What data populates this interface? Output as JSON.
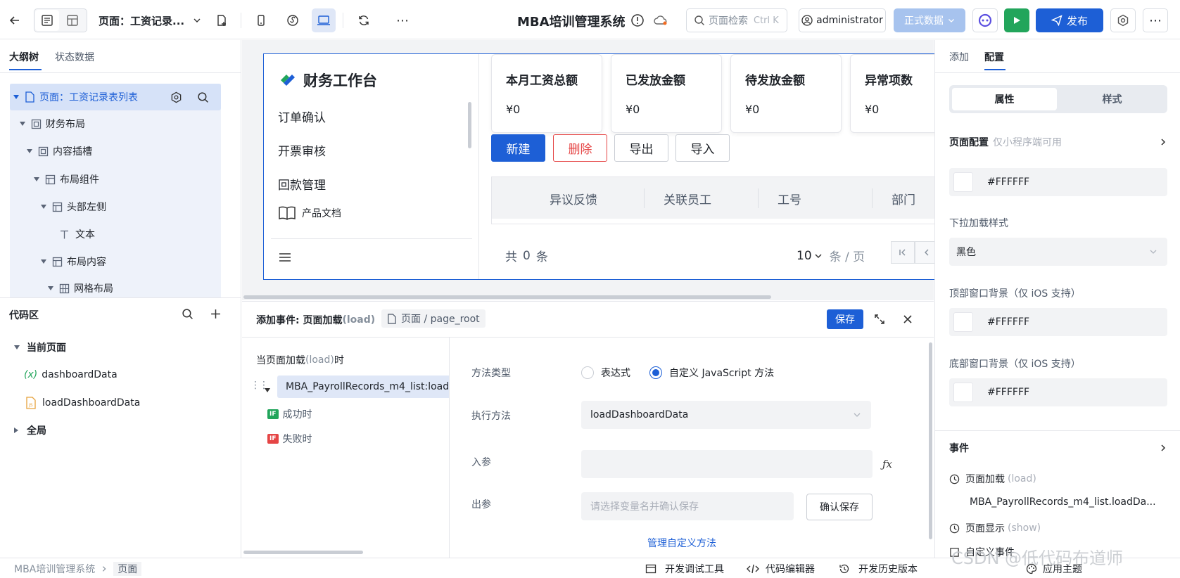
{
  "header": {
    "page_selector": "页面：工资记录...",
    "app_title": "MBA培训管理系统",
    "search_placeholder": "页面检索",
    "search_shortcut": "Ctrl K",
    "user": "administrator",
    "env": "正式数据",
    "publish": "发布"
  },
  "left": {
    "tabs": [
      "大纲树",
      "状态数据"
    ],
    "tree": [
      {
        "label": "页面：工资记录表列表"
      },
      {
        "label": "财务布局"
      },
      {
        "label": "内容插槽"
      },
      {
        "label": "布局组件"
      },
      {
        "label": "头部左侧"
      },
      {
        "label": "文本"
      },
      {
        "label": "布局内容"
      },
      {
        "label": "网格布局"
      }
    ],
    "code_title": "代码区",
    "current_page": "当前页面",
    "vars": [
      "dashboardData",
      "loadDashboardData"
    ],
    "global": "全局"
  },
  "canvas": {
    "logo_title": "财务工作台",
    "menu": [
      "订单确认",
      "开票审核",
      "回款管理"
    ],
    "doc_link": "产品文档",
    "cards": [
      {
        "title": "本月工资总额",
        "value": "¥0"
      },
      {
        "title": "已发放金额",
        "value": "¥0"
      },
      {
        "title": "待发放金额",
        "value": "¥0"
      },
      {
        "title": "异常项数",
        "value": "¥0"
      }
    ],
    "actions": {
      "new": "新建",
      "delete": "删除",
      "export": "导出",
      "import": "导入"
    },
    "columns": [
      "异议反馈",
      "关联员工",
      "工号",
      "部门"
    ],
    "pagination": {
      "total_prefix": "共",
      "total": "0",
      "total_suffix": "条",
      "page_size": "10",
      "per_page": "条 / 页"
    }
  },
  "event": {
    "title": "添加事件: 页面加载",
    "title_sub": "(load)",
    "path": "页面 / page_root",
    "save": "保存",
    "when_label": "当页面加载",
    "when_sub": "(load)",
    "when_suffix": "时",
    "action_item": "MBA_PayrollRecords_m4_list:load",
    "success": "成功时",
    "fail": "失败时",
    "if_badge": "IF",
    "method_type_label": "方法类型",
    "radio_expr": "表达式",
    "radio_js": "自定义 JavaScript 方法",
    "exec_label": "执行方法",
    "exec_value": "loadDashboardData",
    "in_label": "入参",
    "out_label": "出参",
    "out_placeholder": "请选择变量名并确认保存",
    "confirm": "确认保存",
    "manage": "管理自定义方法"
  },
  "right": {
    "tabs": [
      "添加",
      "配置"
    ],
    "seg": [
      "属性",
      "样式"
    ],
    "page_config": "页面配置",
    "page_config_note": "仅小程序端可用",
    "color1": "#FFFFFF",
    "pull_label": "下拉加载样式",
    "pull_value": "黑色",
    "top_bg_label": "顶部窗口背景（仅 iOS 支持）",
    "color2": "#FFFFFF",
    "bottom_bg_label": "底部窗口背景（仅 iOS 支持）",
    "color3": "#FFFFFF",
    "events": "事件",
    "ev_load": "页面加载",
    "ev_load_sub": "(load)",
    "ev_load_value": "MBA_PayrollRecords_m4_list.loadDa...",
    "ev_show": "页面显示",
    "ev_show_sub": "(show)",
    "ev_custom": "自定义事件"
  },
  "status": {
    "crumb_app": "MBA培训管理系统",
    "crumb_page": "页面",
    "devtools": "开发调试工具",
    "code_editor": "代码编辑器",
    "history": "开发历史版本",
    "watermark": "CSDN @低代码布道师",
    "theme": "应用主题"
  },
  "colors": {
    "primary": "#1d5fd6",
    "success": "#22a55b",
    "danger": "#e54545"
  }
}
